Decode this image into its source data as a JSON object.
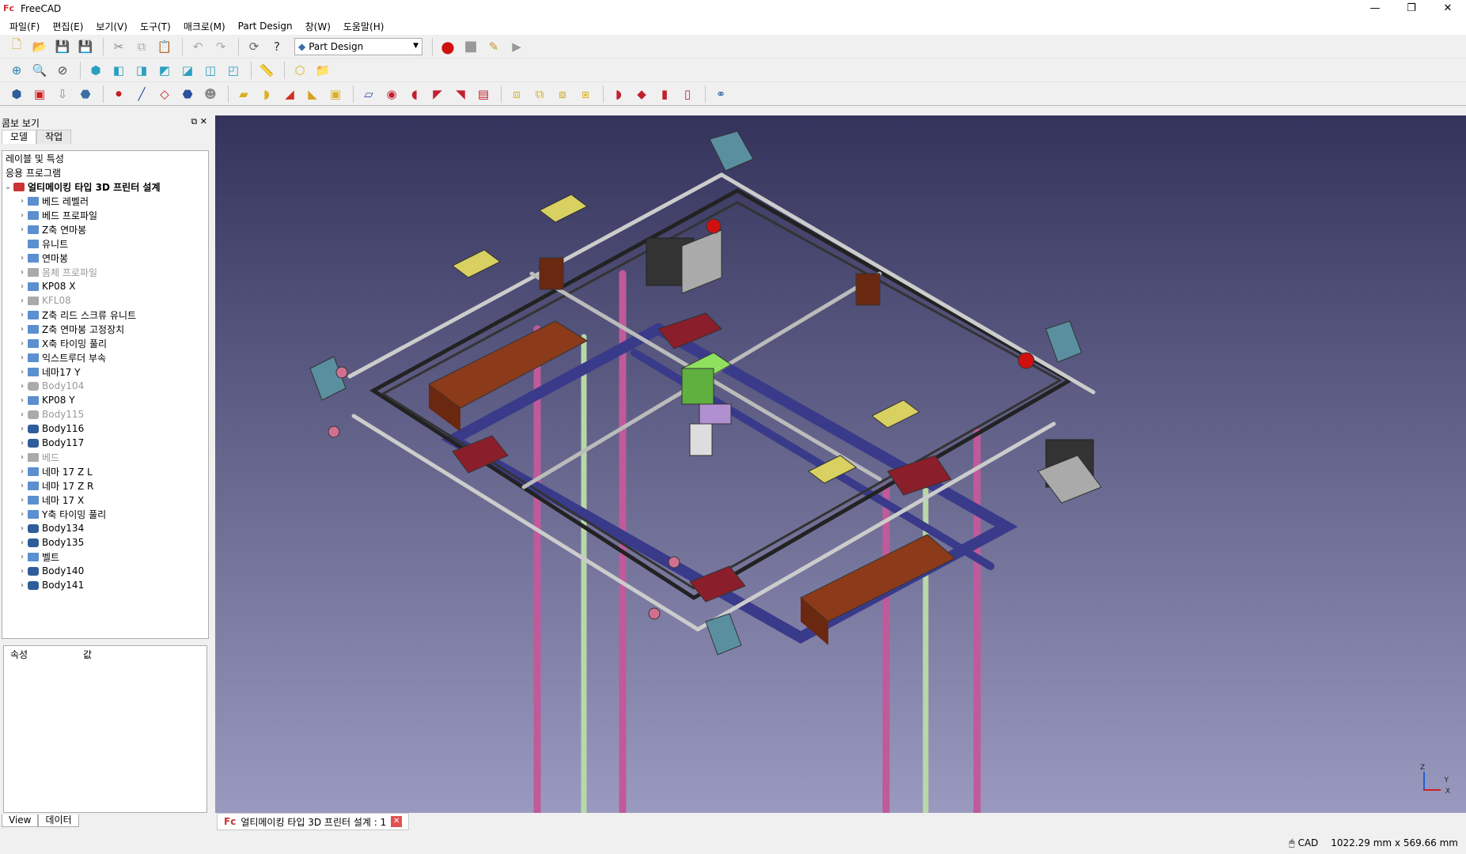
{
  "window": {
    "title": "FreeCAD",
    "app_icon": "freecad-icon",
    "controls": [
      "—",
      "❐",
      "✕"
    ]
  },
  "menu": [
    "파일(F)",
    "편집(E)",
    "보기(V)",
    "도구(T)",
    "매크로(M)",
    "Part Design",
    "창(W)",
    "도움말(H)"
  ],
  "workbench": {
    "selected": "Part Design"
  },
  "combo": {
    "title": "콤보 보기",
    "tabs": [
      "모델",
      "작업"
    ],
    "tree": [
      {
        "label": "레이블 및 특성",
        "level": 0,
        "icon": "none"
      },
      {
        "label": "응용 프로그램",
        "level": 0,
        "icon": "none"
      },
      {
        "label": "얼티메이킹 타입 3D 프린터 설계",
        "level": 1,
        "icon": "document",
        "expanded": true,
        "bold": true
      },
      {
        "label": "베드 레벨러",
        "level": 2,
        "icon": "folder"
      },
      {
        "label": "베드 프로파일",
        "level": 2,
        "icon": "folder"
      },
      {
        "label": "Z축 연마봉",
        "level": 2,
        "icon": "folder"
      },
      {
        "label": "유니트",
        "level": 2,
        "icon": "folder",
        "noexp": true
      },
      {
        "label": "연마봉",
        "level": 2,
        "icon": "folder"
      },
      {
        "label": "몸체 프로파일",
        "level": 2,
        "icon": "folder",
        "grey": true
      },
      {
        "label": "KP08 X",
        "level": 2,
        "icon": "folder"
      },
      {
        "label": "KFL08",
        "level": 2,
        "icon": "folder",
        "grey": true
      },
      {
        "label": "Z축 리드 스크류 유니트",
        "level": 2,
        "icon": "folder"
      },
      {
        "label": "Z축 연마봉 고정장치",
        "level": 2,
        "icon": "folder"
      },
      {
        "label": "X축 타이밍 풀리",
        "level": 2,
        "icon": "folder"
      },
      {
        "label": "익스트루더 부속",
        "level": 2,
        "icon": "folder"
      },
      {
        "label": "네마17 Y",
        "level": 2,
        "icon": "folder"
      },
      {
        "label": "Body104",
        "level": 2,
        "icon": "body",
        "grey": true
      },
      {
        "label": "KP08 Y",
        "level": 2,
        "icon": "folder"
      },
      {
        "label": "Body115",
        "level": 2,
        "icon": "body",
        "grey": true
      },
      {
        "label": "Body116",
        "level": 2,
        "icon": "body"
      },
      {
        "label": "Body117",
        "level": 2,
        "icon": "body"
      },
      {
        "label": "베드",
        "level": 2,
        "icon": "folder",
        "grey": true
      },
      {
        "label": "네마 17 Z L",
        "level": 2,
        "icon": "folder"
      },
      {
        "label": "네마 17 Z R",
        "level": 2,
        "icon": "folder"
      },
      {
        "label": "네마 17 X",
        "level": 2,
        "icon": "folder"
      },
      {
        "label": "Y축 타이밍 풀리",
        "level": 2,
        "icon": "folder"
      },
      {
        "label": "Body134",
        "level": 2,
        "icon": "body"
      },
      {
        "label": "Body135",
        "level": 2,
        "icon": "body"
      },
      {
        "label": "벨트",
        "level": 2,
        "icon": "folder"
      },
      {
        "label": "Body140",
        "level": 2,
        "icon": "body"
      },
      {
        "label": "Body141",
        "level": 2,
        "icon": "body"
      }
    ],
    "props": {
      "col1": "속성",
      "col2": "값"
    },
    "bottom_tabs": [
      "View",
      "데이터"
    ]
  },
  "doc_tab": {
    "label": "얼티메이킹 타입 3D 프린터 설계 : 1"
  },
  "status": {
    "nav": "CAD",
    "dims": "1022.29 mm x 569.66 mm"
  },
  "axes": {
    "x": "X",
    "y": "Y",
    "z": "Z"
  }
}
